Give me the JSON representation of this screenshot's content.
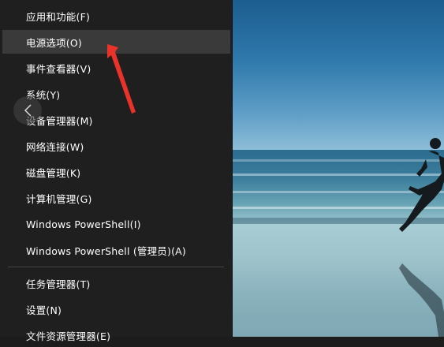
{
  "menu": {
    "items": [
      {
        "label": "应用和功能(F)"
      },
      {
        "label": "电源选项(O)"
      },
      {
        "label": "事件查看器(V)"
      },
      {
        "label": "系统(Y)"
      },
      {
        "label": "设备管理器(M)"
      },
      {
        "label": "网络连接(W)"
      },
      {
        "label": "磁盘管理(K)"
      },
      {
        "label": "计算机管理(G)"
      },
      {
        "label": "Windows PowerShell(I)"
      },
      {
        "label": "Windows PowerShell (管理员)(A)"
      },
      {
        "label": "任务管理器(T)"
      },
      {
        "label": "设置(N)"
      },
      {
        "label": "文件资源管理器(E)"
      }
    ],
    "highlighted_item": "电源选项(O)"
  },
  "colors": {
    "menu_background": "#1f1f1f",
    "highlight": "#3a3a3a",
    "text": "#ffffff",
    "annotation_arrow": "#e8322a"
  },
  "icons": {
    "back": "chevron-left-icon",
    "annotation": "red-arrow"
  }
}
